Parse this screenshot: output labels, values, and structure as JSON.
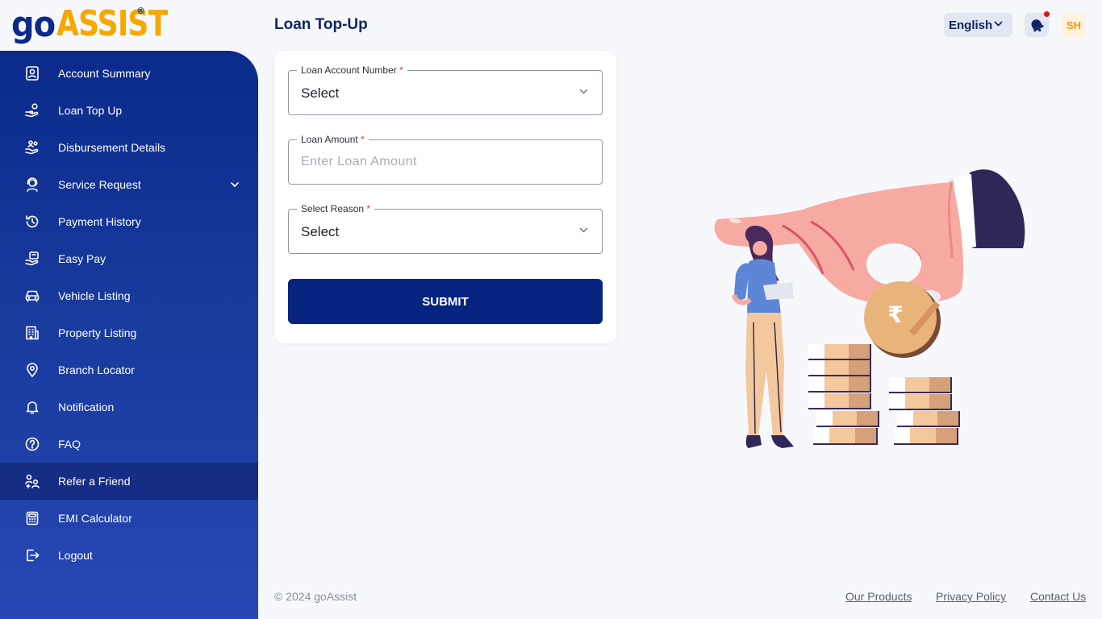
{
  "brand": {
    "name_part1": "go",
    "name_part2": "ASSIST",
    "registered": "®"
  },
  "header": {
    "page_title": "Loan Top-Up",
    "language": "English",
    "avatar_initials": "SH"
  },
  "sidebar": {
    "items": [
      {
        "label": "Account Summary",
        "icon": "user-card-icon"
      },
      {
        "label": "Loan Top Up",
        "icon": "hand-coin-icon"
      },
      {
        "label": "Disbursement Details",
        "icon": "disbursement-icon"
      },
      {
        "label": "Service Request",
        "icon": "support-agent-icon",
        "has_submenu": true
      },
      {
        "label": "Payment History",
        "icon": "history-icon"
      },
      {
        "label": "Easy Pay",
        "icon": "easy-pay-icon"
      },
      {
        "label": "Vehicle Listing",
        "icon": "car-icon"
      },
      {
        "label": "Property Listing",
        "icon": "building-icon"
      },
      {
        "label": "Branch Locator",
        "icon": "location-pin-icon"
      },
      {
        "label": "Notification",
        "icon": "bell-icon"
      },
      {
        "label": "FAQ",
        "icon": "question-icon"
      },
      {
        "label": "Refer a Friend",
        "icon": "refer-friend-icon",
        "active": true
      },
      {
        "label": "EMI Calculator",
        "icon": "calculator-icon"
      },
      {
        "label": "Logout",
        "icon": "logout-icon"
      }
    ]
  },
  "form": {
    "loan_account": {
      "label": "Loan Account Number",
      "required_mark": "*",
      "value": "Select"
    },
    "loan_amount": {
      "label": "Loan Amount",
      "required_mark": "*",
      "placeholder": "Enter Loan Amount",
      "value": ""
    },
    "reason": {
      "label": "Select Reason",
      "required_mark": "*",
      "value": "Select"
    },
    "submit_label": "SUBMIT"
  },
  "illustration": {
    "currency_symbol": "₹"
  },
  "footer": {
    "copyright": "© 2024 goAssist",
    "links": [
      "Our Products",
      "Privacy Policy",
      "Contact Us"
    ]
  },
  "colors": {
    "primary": "#06237f",
    "accent": "#f6a700",
    "sidebar_gradient_top": "#0a2a8c",
    "sidebar_gradient_bottom": "#2747b4",
    "required": "#e23636",
    "notification_dot": "#e8130f"
  }
}
